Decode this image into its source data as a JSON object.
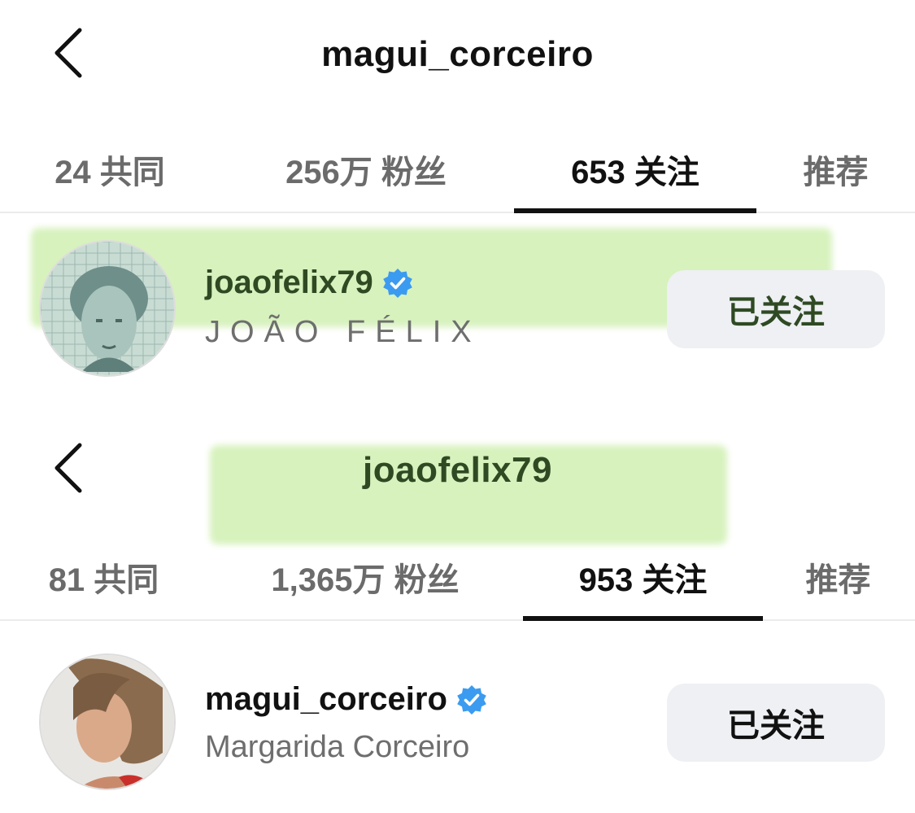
{
  "panel_1": {
    "title": "magui_corceiro",
    "tabs": [
      {
        "label": "24 共同",
        "active": false
      },
      {
        "label": "256万 粉丝",
        "active": false
      },
      {
        "label": "653 关注",
        "active": true
      },
      {
        "label": "推荐",
        "active": false
      }
    ],
    "user": {
      "username": "joaofelix79",
      "full_name": "JOÃO FÉLIX",
      "verified": true,
      "follow_label": "已关注"
    }
  },
  "panel_2": {
    "title": "joaofelix79",
    "tabs": [
      {
        "label": "81 共同",
        "active": false
      },
      {
        "label": "1,365万 粉丝",
        "active": false
      },
      {
        "label": "953 关注",
        "active": true
      },
      {
        "label": "推荐",
        "active": false
      }
    ],
    "user": {
      "username": "magui_corceiro",
      "full_name": "Margarida Corceiro",
      "verified": true,
      "follow_label": "已关注"
    }
  },
  "colors": {
    "highlight": "#cceeaa",
    "verified_badge": "#3b9bf0",
    "button_bg": "#eef0f3",
    "tab_inactive": "#6b6b6b",
    "highlight_text": "#2f4a23"
  },
  "icons": {
    "back": "chevron-left-icon",
    "verified": "verified-badge-icon"
  }
}
